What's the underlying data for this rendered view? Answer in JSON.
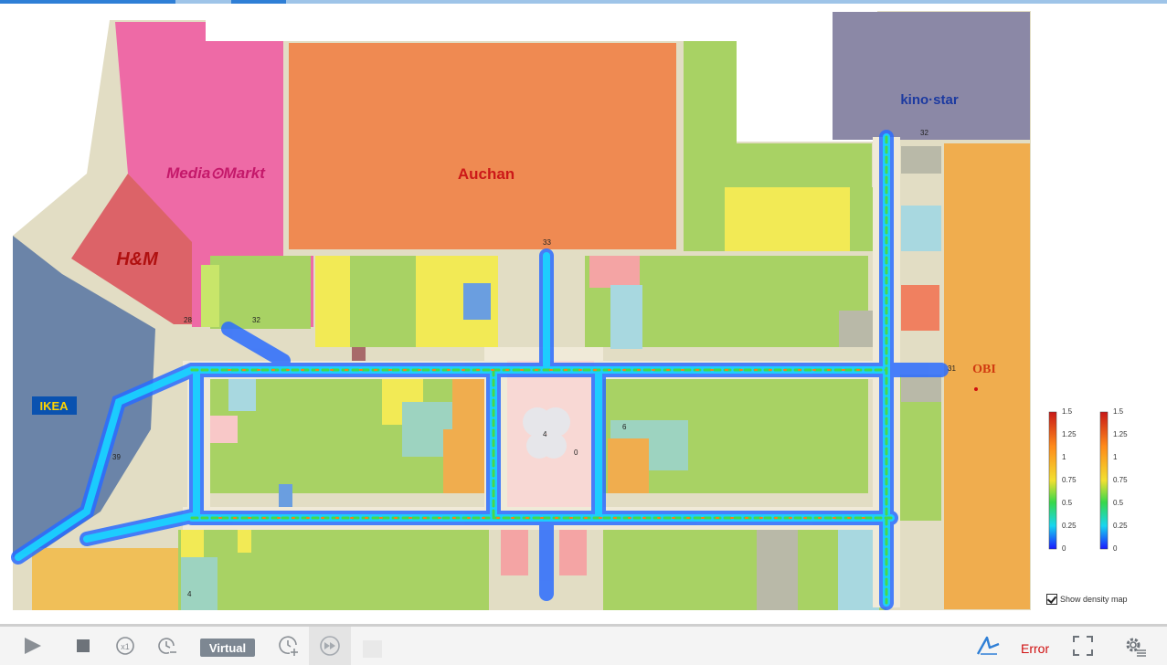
{
  "stores": {
    "mediamarkt": "Media⊙Markt",
    "auchan": "Auchan",
    "hm": "H&M",
    "ikea": "IKEA",
    "kinostar": "kino·star",
    "obi": "OBI"
  },
  "zone_labels": {
    "ikea_id": "39",
    "auchan_id": "33",
    "kino_id": "32",
    "obi_id": "31",
    "hm_id": "28",
    "mm_id": "32",
    "central": "4",
    "central_b": "0",
    "central_c": "6",
    "bottom_left": "4"
  },
  "legend": {
    "left_ticks": [
      "1.5",
      "1.25",
      "1",
      "0.75",
      "0.5",
      "0.25",
      "0"
    ],
    "right_ticks": [
      "1.5",
      "1.25",
      "1",
      "0.75",
      "0.5",
      "0.25",
      "0"
    ]
  },
  "density_toggle": {
    "label": "Show density map",
    "checked": true
  },
  "toolbar": {
    "virtual_label": "Virtual",
    "error_label": "Error"
  },
  "icons": [
    "play-icon",
    "stop-icon",
    "speed-x1-icon",
    "clock-back-icon",
    "clock-add-icon",
    "fast-forward-icon",
    "route-icon",
    "fullscreen-icon",
    "settings-icon"
  ],
  "colors": {
    "accent": "#2f7fd6",
    "error": "#d01010",
    "ikea": "#6b84a8",
    "hm": "#dc6368",
    "mediamarkt": "#ee6aa6",
    "auchan": "#ef8a52",
    "kinostar": "#8b88a6",
    "obi": "#f0ad4e",
    "shop_green": "#a8d264",
    "corridor": "#e2ddc4"
  }
}
